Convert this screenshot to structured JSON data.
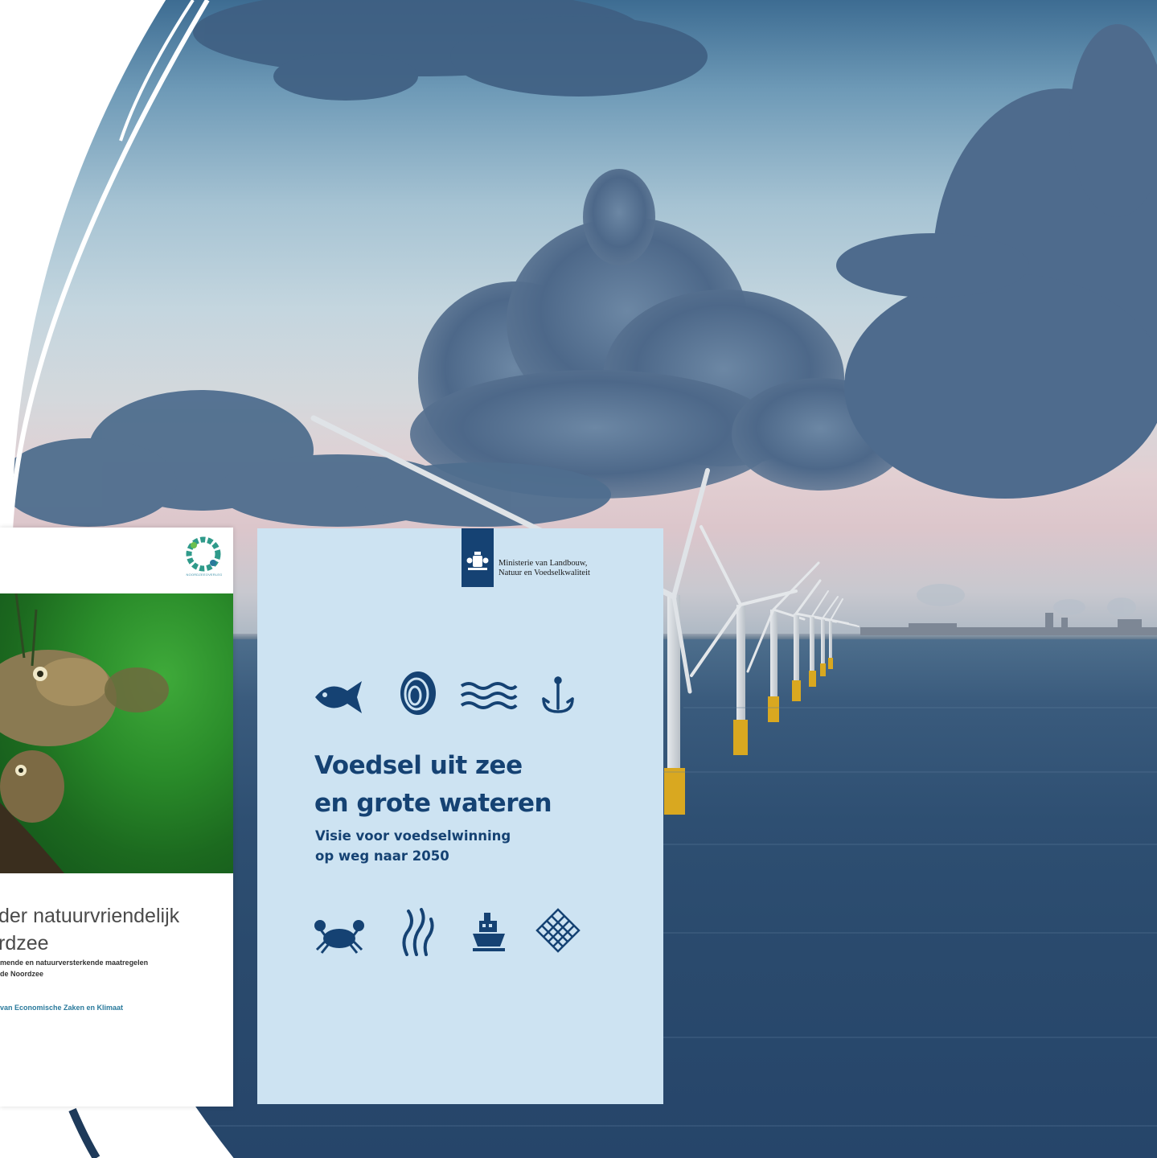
{
  "background": {
    "scene": "offshore wind farm at sea under cloudy sky",
    "sky_color": "#a6c3d3",
    "sea_color": "#2e4f72"
  },
  "cover_left": {
    "title_line1": "der natuurvriendelijk",
    "title_line2": "rdzee",
    "subtitle_line1": "mende en natuurversterkende maatregelen",
    "subtitle_line2": "de Noordzee",
    "organisation": "van Economische Zaken en Klimaat",
    "logo_caption": "NOORDZEEOVERLEG",
    "accent_color": "#2a7a9c"
  },
  "cover_right": {
    "ministry_line1": "Ministerie van Landbouw,",
    "ministry_line2": "Natuur en Voedselkwaliteit",
    "title_line1": "Voedsel uit zee",
    "title_line2": "en grote wateren",
    "subtitle_line1": "Visie voor voedselwinning",
    "subtitle_line2": "op weg naar 2050",
    "top_icons": [
      "fish-icon",
      "shell-icon",
      "waves-icon",
      "fishhook-icon"
    ],
    "bottom_icons": [
      "crab-icon",
      "seaweed-icon",
      "ship-icon",
      "fishing-net-icon"
    ],
    "background_color": "#cde3f2",
    "brand_color": "#154273"
  }
}
